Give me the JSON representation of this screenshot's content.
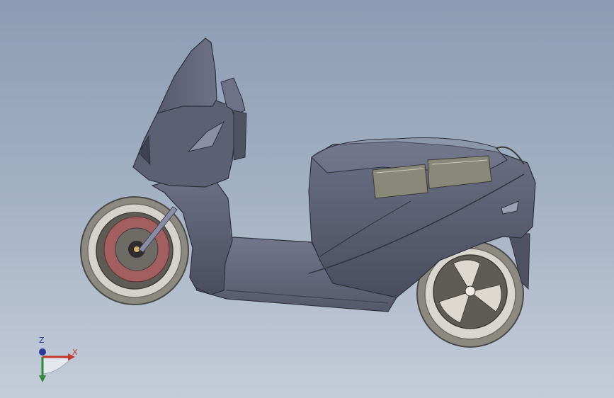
{
  "viewport": {
    "background_top": "#8c9cb4",
    "background_bottom": "#c4ccd8"
  },
  "model": {
    "body_color": "#5c6074",
    "body_dark": "#3f4252",
    "body_light": "#8a8ea4",
    "tire_color": "#8c8a80",
    "disc_color": "#a35f60",
    "rim_color": "#5f5b56",
    "battery_color": "#8a8878"
  },
  "triad": {
    "x_label": "X",
    "z_label": "Z",
    "x_color": "#c23a2c",
    "y_color": "#2e8a3a",
    "z_color": "#2a3d9a"
  }
}
